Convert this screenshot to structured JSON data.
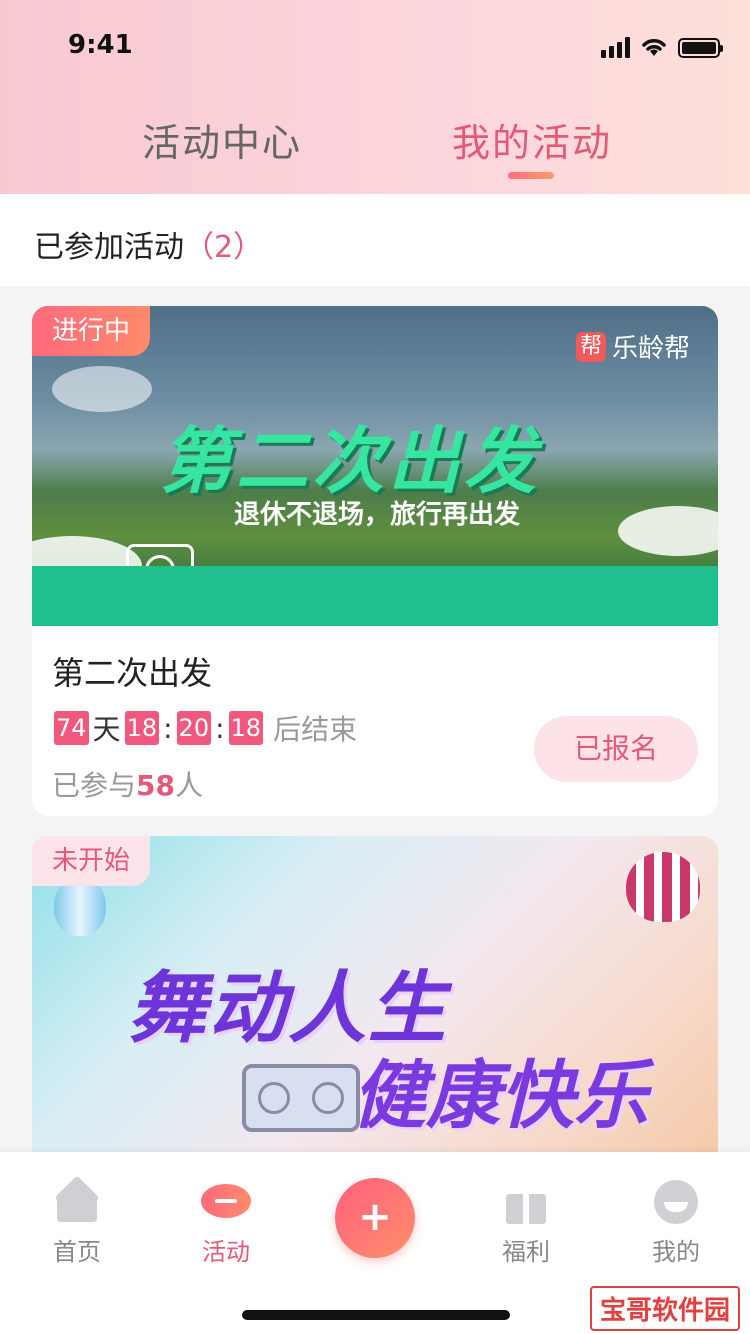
{
  "status_bar": {
    "time": "9:41"
  },
  "tabs": [
    {
      "label": "活动中心",
      "active": false
    },
    {
      "label": "我的活动",
      "active": true
    }
  ],
  "joined": {
    "label": "已参加活动",
    "count": "（2）"
  },
  "activities": [
    {
      "badge": "进行中",
      "banner_logo_mark": "帮",
      "banner_logo_text": "乐龄帮",
      "banner_title": "第二次出发",
      "banner_subtitle": "退休不退场，旅行再出发",
      "title": "第二次出发",
      "countdown": {
        "days": "74",
        "day_unit": "天",
        "hours": "18",
        "minutes": "20",
        "seconds": "18",
        "suffix": "后结束",
        "sep": ":"
      },
      "participants_prefix": "已参与",
      "participants_count": "58",
      "participants_suffix": "人",
      "button": "已报名"
    },
    {
      "badge": "未开始",
      "banner_title_line1": "舞动人生",
      "banner_title_line2": "健康快乐"
    }
  ],
  "tabbar": {
    "items": [
      {
        "label": "首页",
        "icon": "home-icon"
      },
      {
        "label": "活动",
        "icon": "activity-icon",
        "active": true
      },
      {
        "label": "+",
        "icon": "plus-icon"
      },
      {
        "label": "福利",
        "icon": "gift-icon"
      },
      {
        "label": "我的",
        "icon": "profile-icon"
      }
    ]
  },
  "watermark": "宝哥软件园",
  "colors": {
    "accent": "#e35a78",
    "gradient_start": "#ff6a7d",
    "gradient_end": "#ff8a6a"
  }
}
